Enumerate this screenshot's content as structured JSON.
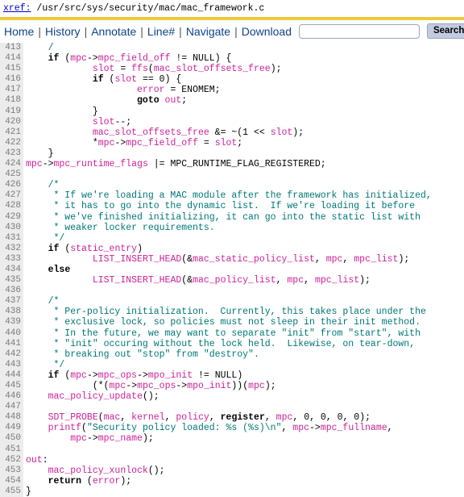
{
  "header": {
    "xref_label": "xref:",
    "path": " /usr/src/sys/security/mac/mac_framework.c"
  },
  "nav": {
    "links": [
      "Home",
      "History",
      "Annotate",
      "Line#",
      "Navigate",
      "Download"
    ],
    "separator": "|",
    "search_value": "",
    "search_placeholder": "",
    "search_button": "Search"
  },
  "code": {
    "lines": [
      {
        "no": "413",
        "tokens": [
          {
            "t": "pl",
            "s": "    "
          },
          {
            "t": "cm",
            "s": "/"
          }
        ]
      },
      {
        "no": "414",
        "tokens": [
          {
            "t": "pl",
            "s": "    "
          },
          {
            "t": "kw",
            "s": "if"
          },
          {
            "t": "pl",
            "s": " ("
          },
          {
            "t": "id",
            "s": "mpc"
          },
          {
            "t": "pl",
            "s": "->"
          },
          {
            "t": "id",
            "s": "mpc_field_off"
          },
          {
            "t": "pl",
            "s": " != "
          },
          {
            "t": "pl",
            "s": "NULL) {"
          }
        ]
      },
      {
        "no": "415",
        "tokens": [
          {
            "t": "pl",
            "s": "            "
          },
          {
            "t": "id",
            "s": "slot"
          },
          {
            "t": "pl",
            "s": " = "
          },
          {
            "t": "id",
            "s": "ffs"
          },
          {
            "t": "pl",
            "s": "("
          },
          {
            "t": "id",
            "s": "mac_slot_offsets_free"
          },
          {
            "t": "pl",
            "s": ");"
          }
        ]
      },
      {
        "no": "416",
        "tokens": [
          {
            "t": "pl",
            "s": "            "
          },
          {
            "t": "kw",
            "s": "if"
          },
          {
            "t": "pl",
            "s": " ("
          },
          {
            "t": "id",
            "s": "slot"
          },
          {
            "t": "pl",
            "s": " == 0) {"
          }
        ]
      },
      {
        "no": "417",
        "tokens": [
          {
            "t": "pl",
            "s": "                    "
          },
          {
            "t": "id",
            "s": "error"
          },
          {
            "t": "pl",
            "s": " = "
          },
          {
            "t": "pl",
            "s": "ENOMEM;"
          }
        ]
      },
      {
        "no": "418",
        "tokens": [
          {
            "t": "pl",
            "s": "                    "
          },
          {
            "t": "kw",
            "s": "goto"
          },
          {
            "t": "pl",
            "s": " "
          },
          {
            "t": "id",
            "s": "out"
          },
          {
            "t": "pl",
            "s": ";"
          }
        ]
      },
      {
        "no": "419",
        "tokens": [
          {
            "t": "pl",
            "s": "            }"
          }
        ]
      },
      {
        "no": "420",
        "tokens": [
          {
            "t": "pl",
            "s": "            "
          },
          {
            "t": "id",
            "s": "slot"
          },
          {
            "t": "pl",
            "s": "--;"
          }
        ]
      },
      {
        "no": "421",
        "tokens": [
          {
            "t": "pl",
            "s": "            "
          },
          {
            "t": "id",
            "s": "mac_slot_offsets_free"
          },
          {
            "t": "pl",
            "s": " &= ~(1 << "
          },
          {
            "t": "id",
            "s": "slot"
          },
          {
            "t": "pl",
            "s": ");"
          }
        ]
      },
      {
        "no": "422",
        "tokens": [
          {
            "t": "pl",
            "s": "            *"
          },
          {
            "t": "id",
            "s": "mpc"
          },
          {
            "t": "pl",
            "s": "->"
          },
          {
            "t": "id",
            "s": "mpc_field_off"
          },
          {
            "t": "pl",
            "s": " = "
          },
          {
            "t": "id",
            "s": "slot"
          },
          {
            "t": "pl",
            "s": ";"
          }
        ]
      },
      {
        "no": "423",
        "tokens": [
          {
            "t": "pl",
            "s": "    }"
          }
        ]
      },
      {
        "no": "424",
        "tokens": [
          {
            "t": "id",
            "s": "mpc"
          },
          {
            "t": "pl",
            "s": "->"
          },
          {
            "t": "id",
            "s": "mpc_runtime_flags"
          },
          {
            "t": "pl",
            "s": " |= MPC_RUNTIME_FLAG_REGISTERED;"
          }
        ]
      },
      {
        "no": "425",
        "tokens": [
          {
            "t": "pl",
            "s": ""
          }
        ]
      },
      {
        "no": "426",
        "tokens": [
          {
            "t": "cm",
            "s": "    /*"
          }
        ]
      },
      {
        "no": "427",
        "tokens": [
          {
            "t": "cm",
            "s": "     * If we're loading a MAC module after the framework has initialized,"
          }
        ]
      },
      {
        "no": "428",
        "tokens": [
          {
            "t": "cm",
            "s": "     * it has to go into the dynamic list.  If we're loading it before"
          }
        ]
      },
      {
        "no": "429",
        "tokens": [
          {
            "t": "cm",
            "s": "     * we've finished initializing, it can go into the static list with"
          }
        ]
      },
      {
        "no": "430",
        "tokens": [
          {
            "t": "cm",
            "s": "     * weaker locker requirements."
          }
        ]
      },
      {
        "no": "431",
        "tokens": [
          {
            "t": "cm",
            "s": "     */"
          }
        ]
      },
      {
        "no": "432",
        "tokens": [
          {
            "t": "pl",
            "s": "    "
          },
          {
            "t": "kw",
            "s": "if"
          },
          {
            "t": "pl",
            "s": " ("
          },
          {
            "t": "id",
            "s": "static_entry"
          },
          {
            "t": "pl",
            "s": ")"
          }
        ]
      },
      {
        "no": "433",
        "tokens": [
          {
            "t": "pl",
            "s": "            "
          },
          {
            "t": "id",
            "s": "LIST_INSERT_HEAD"
          },
          {
            "t": "pl",
            "s": "(&"
          },
          {
            "t": "id",
            "s": "mac_static_policy_list"
          },
          {
            "t": "pl",
            "s": ", "
          },
          {
            "t": "id",
            "s": "mpc"
          },
          {
            "t": "pl",
            "s": ", "
          },
          {
            "t": "id",
            "s": "mpc_list"
          },
          {
            "t": "pl",
            "s": ");"
          }
        ]
      },
      {
        "no": "434",
        "tokens": [
          {
            "t": "pl",
            "s": "    "
          },
          {
            "t": "kw",
            "s": "else"
          }
        ]
      },
      {
        "no": "435",
        "tokens": [
          {
            "t": "pl",
            "s": "            "
          },
          {
            "t": "id",
            "s": "LIST_INSERT_HEAD"
          },
          {
            "t": "pl",
            "s": "(&"
          },
          {
            "t": "id",
            "s": "mac_policy_list"
          },
          {
            "t": "pl",
            "s": ", "
          },
          {
            "t": "id",
            "s": "mpc"
          },
          {
            "t": "pl",
            "s": ", "
          },
          {
            "t": "id",
            "s": "mpc_list"
          },
          {
            "t": "pl",
            "s": ");"
          }
        ]
      },
      {
        "no": "436",
        "tokens": [
          {
            "t": "pl",
            "s": ""
          }
        ]
      },
      {
        "no": "437",
        "tokens": [
          {
            "t": "cm",
            "s": "    /*"
          }
        ]
      },
      {
        "no": "438",
        "tokens": [
          {
            "t": "cm",
            "s": "     * Per-policy initialization.  Currently, this takes place under the"
          }
        ]
      },
      {
        "no": "439",
        "tokens": [
          {
            "t": "cm",
            "s": "     * exclusive lock, so policies must not sleep in their init method."
          }
        ]
      },
      {
        "no": "440",
        "tokens": [
          {
            "t": "cm",
            "s": "     * In the future, we may want to separate \"init\" from \"start\", with"
          }
        ]
      },
      {
        "no": "441",
        "tokens": [
          {
            "t": "cm",
            "s": "     * \"init\" occuring without the lock held.  Likewise, on tear-down,"
          }
        ]
      },
      {
        "no": "442",
        "tokens": [
          {
            "t": "cm",
            "s": "     * breaking out \"stop\" from \"destroy\"."
          }
        ]
      },
      {
        "no": "443",
        "tokens": [
          {
            "t": "cm",
            "s": "     */"
          }
        ]
      },
      {
        "no": "444",
        "tokens": [
          {
            "t": "pl",
            "s": "    "
          },
          {
            "t": "kw",
            "s": "if"
          },
          {
            "t": "pl",
            "s": " ("
          },
          {
            "t": "id",
            "s": "mpc"
          },
          {
            "t": "pl",
            "s": "->"
          },
          {
            "t": "id",
            "s": "mpc_ops"
          },
          {
            "t": "pl",
            "s": "->"
          },
          {
            "t": "id",
            "s": "mpo_init"
          },
          {
            "t": "pl",
            "s": " != NULL)"
          }
        ]
      },
      {
        "no": "445",
        "tokens": [
          {
            "t": "pl",
            "s": "            (*("
          },
          {
            "t": "id",
            "s": "mpc"
          },
          {
            "t": "pl",
            "s": "->"
          },
          {
            "t": "id",
            "s": "mpc_ops"
          },
          {
            "t": "pl",
            "s": "->"
          },
          {
            "t": "id",
            "s": "mpo_init"
          },
          {
            "t": "pl",
            "s": "))("
          },
          {
            "t": "id",
            "s": "mpc"
          },
          {
            "t": "pl",
            "s": ");"
          }
        ]
      },
      {
        "no": "446",
        "tokens": [
          {
            "t": "pl",
            "s": "    "
          },
          {
            "t": "id",
            "s": "mac_policy_update"
          },
          {
            "t": "pl",
            "s": "();"
          }
        ]
      },
      {
        "no": "447",
        "tokens": [
          {
            "t": "pl",
            "s": ""
          }
        ]
      },
      {
        "no": "448",
        "tokens": [
          {
            "t": "pl",
            "s": "    "
          },
          {
            "t": "id",
            "s": "SDT_PROBE"
          },
          {
            "t": "pl",
            "s": "("
          },
          {
            "t": "id",
            "s": "mac"
          },
          {
            "t": "pl",
            "s": ", "
          },
          {
            "t": "id",
            "s": "kernel"
          },
          {
            "t": "pl",
            "s": ", "
          },
          {
            "t": "id",
            "s": "policy"
          },
          {
            "t": "pl",
            "s": ", "
          },
          {
            "t": "kw",
            "s": "register"
          },
          {
            "t": "pl",
            "s": ", "
          },
          {
            "t": "id",
            "s": "mpc"
          },
          {
            "t": "pl",
            "s": ", 0, 0, 0, 0);"
          }
        ]
      },
      {
        "no": "449",
        "tokens": [
          {
            "t": "pl",
            "s": "    "
          },
          {
            "t": "id",
            "s": "printf"
          },
          {
            "t": "pl",
            "s": "("
          },
          {
            "t": "str",
            "s": "\"Security policy loaded: %s (%s)\\n\""
          },
          {
            "t": "pl",
            "s": ", "
          },
          {
            "t": "id",
            "s": "mpc"
          },
          {
            "t": "pl",
            "s": "->"
          },
          {
            "t": "id",
            "s": "mpc_fullname"
          },
          {
            "t": "pl",
            "s": ","
          }
        ]
      },
      {
        "no": "450",
        "tokens": [
          {
            "t": "pl",
            "s": "        "
          },
          {
            "t": "id",
            "s": "mpc"
          },
          {
            "t": "pl",
            "s": "->"
          },
          {
            "t": "id",
            "s": "mpc_name"
          },
          {
            "t": "pl",
            "s": ");"
          }
        ]
      },
      {
        "no": "451",
        "tokens": [
          {
            "t": "pl",
            "s": ""
          }
        ]
      },
      {
        "no": "452",
        "tokens": [
          {
            "t": "id",
            "s": "out"
          },
          {
            "t": "pl",
            "s": ":"
          }
        ]
      },
      {
        "no": "453",
        "tokens": [
          {
            "t": "pl",
            "s": "    "
          },
          {
            "t": "id",
            "s": "mac_policy_xunlock"
          },
          {
            "t": "pl",
            "s": "();"
          }
        ]
      },
      {
        "no": "454",
        "tokens": [
          {
            "t": "pl",
            "s": "    "
          },
          {
            "t": "kw",
            "s": "return"
          },
          {
            "t": "pl",
            "s": " ("
          },
          {
            "t": "id",
            "s": "error"
          },
          {
            "t": "pl",
            "s": ");"
          }
        ]
      },
      {
        "no": "455",
        "tokens": [
          {
            "t": "pl",
            "s": "}"
          }
        ]
      }
    ]
  }
}
